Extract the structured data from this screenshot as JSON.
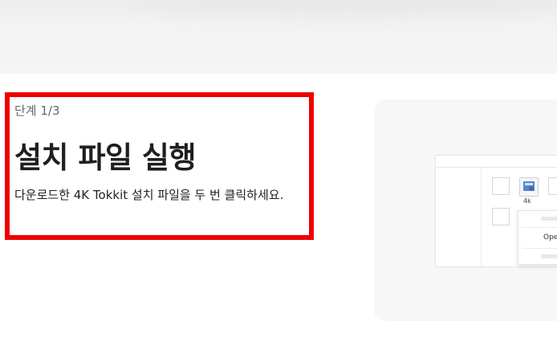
{
  "step": {
    "label": "단계 1/3"
  },
  "main": {
    "title": "설치 파일 실행",
    "description": "다운로드한 4K Tokkit 설치 파일을 두 번 클릭하세요."
  },
  "preview": {
    "file_caption": "4k",
    "context_menu": {
      "open_label": "Ope"
    }
  },
  "colors": {
    "highlight": "#ee0000"
  }
}
